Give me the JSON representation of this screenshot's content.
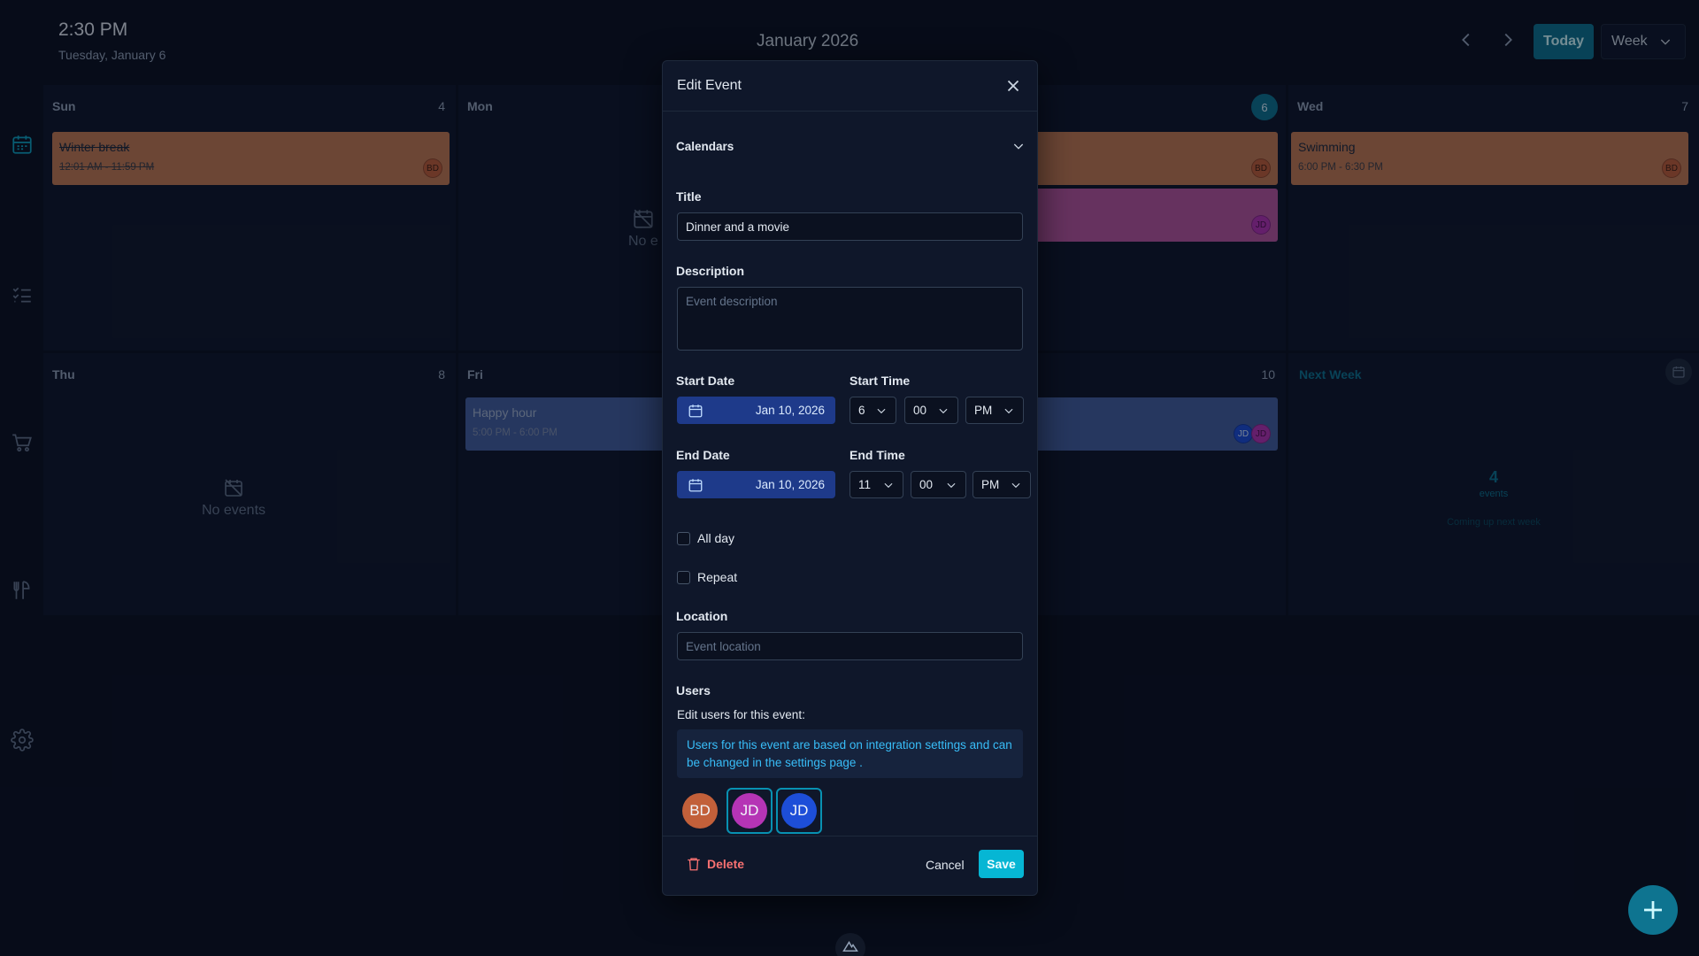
{
  "header": {
    "time": "2:30 PM",
    "date": "Tuesday, January 6",
    "month_title": "January 2026",
    "today_label": "Today",
    "view_label": "Week"
  },
  "calendar": {
    "row1": {
      "sun": {
        "name": "Sun",
        "num": "4"
      },
      "mon": {
        "name": "Mon",
        "no_events": "No e"
      },
      "tue": {
        "num": "6"
      },
      "wed": {
        "name": "Wed",
        "num": "7"
      }
    },
    "row2": {
      "thu": {
        "name": "Thu",
        "num": "8",
        "no_events": "No events"
      },
      "fri": {
        "name": "Fri"
      },
      "sat": {
        "num": "10"
      },
      "next_week": {
        "label": "Next Week",
        "count": "4",
        "count_label": "events",
        "sub": "Coming up next week"
      }
    },
    "events": {
      "winter_break": {
        "title": "Winter break",
        "time": "12:01 AM - 11:59 PM",
        "avatar": "BD"
      },
      "tue_event_1": {
        "avatar": "BD"
      },
      "tue_event_2": {
        "avatar": "JD"
      },
      "swimming": {
        "title": "Swimming",
        "time": "6:00 PM - 6:30 PM",
        "avatar": "BD"
      },
      "happy_hour": {
        "title": "Happy hour",
        "time": "5:00 PM - 6:00 PM"
      },
      "sat_event": {
        "avatar1": "JD",
        "avatar2": "JD"
      }
    }
  },
  "modal": {
    "title": "Edit Event",
    "calendars_label": "Calendars",
    "title_label": "Title",
    "title_value": "Dinner and a movie",
    "description_label": "Description",
    "description_placeholder": "Event description",
    "start_date_label": "Start Date",
    "start_date_value": "Jan 10, 2026",
    "start_time_label": "Start Time",
    "start_hour": "6",
    "start_minute": "00",
    "start_ampm": "PM",
    "end_date_label": "End Date",
    "end_date_value": "Jan 10, 2026",
    "end_time_label": "End Time",
    "end_hour": "11",
    "end_minute": "00",
    "end_ampm": "PM",
    "all_day_label": "All day",
    "repeat_label": "Repeat",
    "location_label": "Location",
    "location_placeholder": "Event location",
    "users_label": "Users",
    "users_sub": "Edit users for this event:",
    "users_info": "Users for this event are based on integration settings and can be changed in the settings page .",
    "users": [
      {
        "initials": "BD",
        "color": "#c2603a",
        "selected": false
      },
      {
        "initials": "JD",
        "color": "#b534b5",
        "selected": true
      },
      {
        "initials": "JD",
        "color": "#1d4ed8",
        "selected": true
      }
    ],
    "delete_label": "Delete",
    "cancel_label": "Cancel",
    "save_label": "Save"
  },
  "colors": {
    "accent": "#06b6d4",
    "event_orange": "#c47a52",
    "event_pink": "#b8579f",
    "event_blue": "#44609e"
  }
}
